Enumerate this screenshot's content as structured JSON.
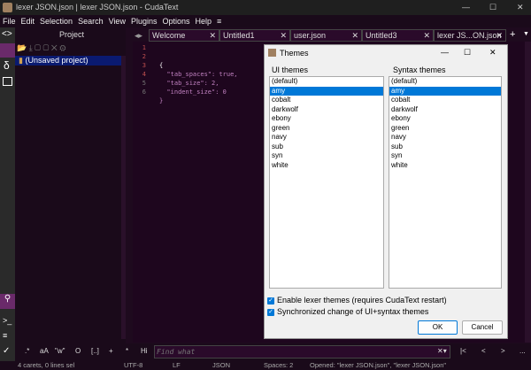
{
  "window": {
    "title": "lexer JSON.json | lexer JSON.json - CudaText",
    "minimize": "—",
    "maximize": "☐",
    "close": "✕"
  },
  "menu": [
    "File",
    "Edit",
    "Selection",
    "Search",
    "View",
    "Plugins",
    "Options",
    "Help",
    "≡"
  ],
  "project": {
    "title": "Project",
    "root": "(Unsaved project)"
  },
  "tabs": [
    {
      "label": "Welcome",
      "modified": false
    },
    {
      "label": "Untitled1",
      "modified": true
    },
    {
      "label": "user.json",
      "modified": false
    },
    {
      "label": "Untitled3",
      "modified": true
    },
    {
      "label": "lexer JS...ON.json",
      "modified": false
    }
  ],
  "editor": {
    "line_numbers": [
      "1",
      "2",
      "3",
      "4",
      "5",
      "6"
    ],
    "lines": [
      "{",
      "  \"tab_spaces\": true,",
      "  \"tab_size\": 2,",
      "  \"indent_size\": 0",
      "}",
      ""
    ]
  },
  "dialog": {
    "title": "Themes",
    "ui_label": "UI themes",
    "syntax_label": "Syntax themes",
    "ui_themes": [
      "(default)",
      "amy",
      "cobalt",
      "darkwolf",
      "ebony",
      "green",
      "navy",
      "sub",
      "syn",
      "white"
    ],
    "syntax_themes": [
      "(default)",
      "amy",
      "cobalt",
      "darkwolf",
      "ebony",
      "green",
      "navy",
      "sub",
      "syn",
      "white"
    ],
    "selected": "amy",
    "check1": "Enable lexer themes (requires CudaText restart)",
    "check1_checked": true,
    "check2": "Synchronized change of UI+syntax themes",
    "check2_checked": true,
    "ok": "OK",
    "cancel": "Cancel"
  },
  "find": {
    "buttons": [
      ".*",
      "aA",
      "\"w\"",
      "O",
      "[..]",
      "+",
      "*",
      "Hi"
    ],
    "placeholder": "Find what",
    "nav": [
      "|<",
      "<",
      ">",
      "..."
    ]
  },
  "status": {
    "carets": "4 carets, 0 lines sel",
    "encoding": "UTF-8",
    "eol": "LF",
    "lexer": "JSON",
    "spaces": "Spaces: 2",
    "message": "Opened: \"lexer JSON.json\", \"lexer JSON.json\""
  },
  "colors": {
    "accent": "#0078d7",
    "bg": "#1e061e"
  }
}
